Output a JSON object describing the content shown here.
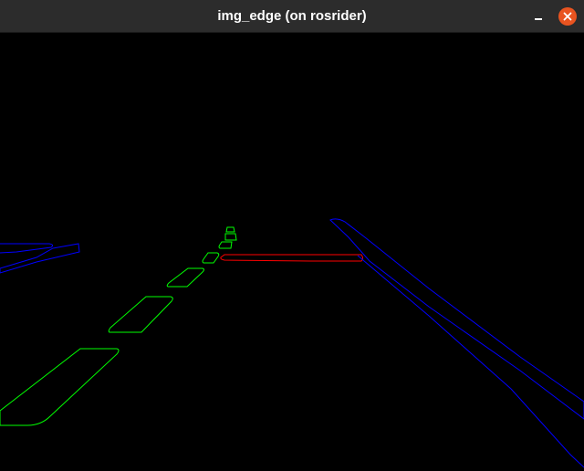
{
  "window": {
    "title": "img_edge (on rosrider)"
  },
  "colors": {
    "titlebar": "#2c2c2c",
    "title_text": "#ffffff",
    "close_button": "#e95420",
    "background": "#000000",
    "green_contours": "#00ff00",
    "red_contour": "#ff0000",
    "blue_contours": "#0000ff"
  },
  "icons": {
    "minimize": "minimize-icon",
    "close": "close-icon"
  }
}
